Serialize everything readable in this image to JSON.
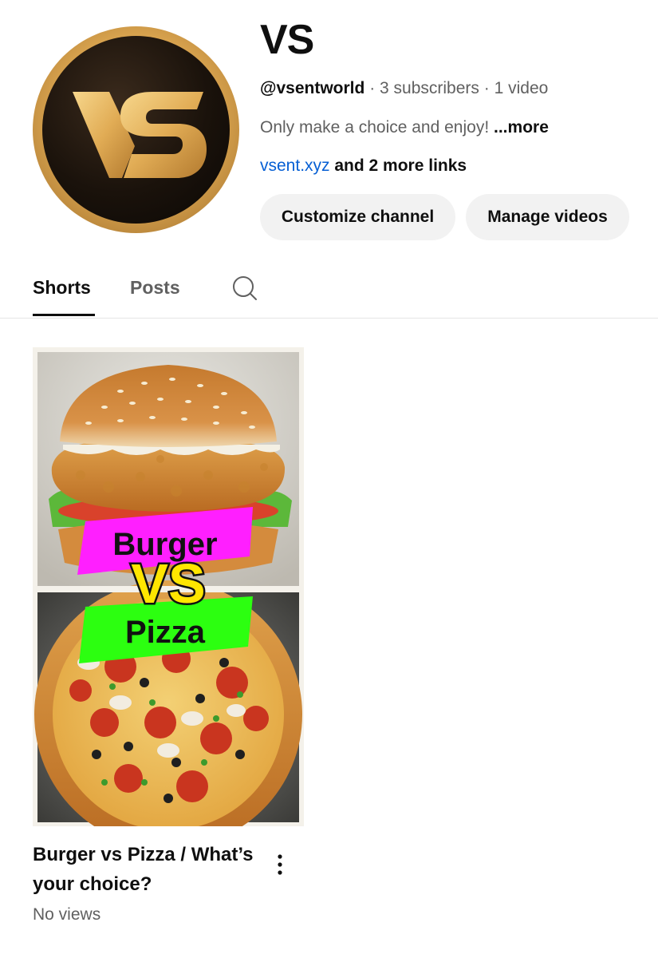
{
  "channel": {
    "name": "VS",
    "handle": "@vsentworld",
    "subscribers": "3 subscribers",
    "videos": "1 video",
    "separator": "·",
    "description": "Only make a choice and enjoy!",
    "more_label": "...more",
    "link_text": "vsent.xyz",
    "more_links": "and 2 more links",
    "avatar_icon": "vs-logo-icon",
    "avatar_letters": "VS"
  },
  "buttons": {
    "customize": "Customize channel",
    "manage": "Manage videos"
  },
  "tabs": [
    {
      "label": "Shorts",
      "active": true
    },
    {
      "label": "Posts",
      "active": false
    }
  ],
  "search_icon": "search-icon",
  "shorts": [
    {
      "title": "Burger vs Pizza / What’s your choice?",
      "views": "No views",
      "thumbnail": {
        "top_label": "Burger",
        "vs_label": "VS",
        "bottom_label": "Pizza",
        "top_label_color": "#ff1fff",
        "bottom_label_color": "#2cff10",
        "vs_color": "#ffe600"
      },
      "menu_icon": "more-vert-icon"
    }
  ],
  "colors": {
    "link": "#065fd4",
    "secondary_text": "#606060",
    "button_bg": "#f2f2f2"
  }
}
